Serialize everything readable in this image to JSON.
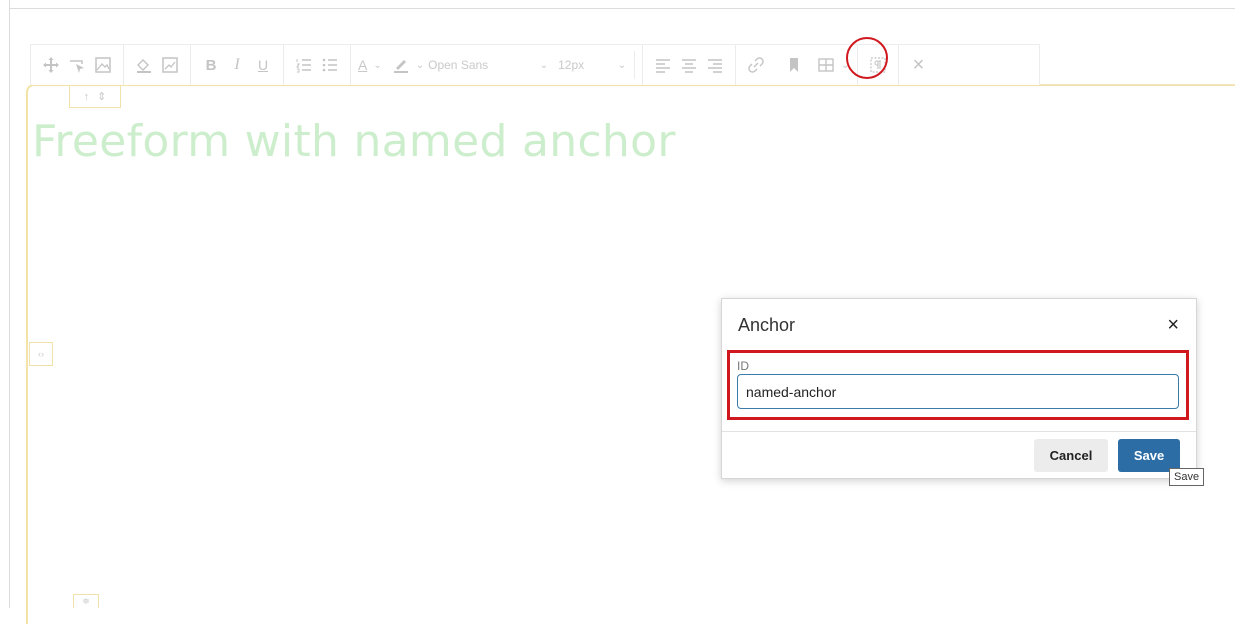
{
  "heading": "Freeform with named anchor",
  "toolbar": {
    "font_family": "Open Sans",
    "font_size": "12px",
    "bold": "B",
    "italic": "I",
    "underline": "U",
    "text_color": "A",
    "close": "×"
  },
  "block": {
    "tab_up": "↑",
    "tab_move": "⇕",
    "side_handle": "‹›",
    "bottom_handle": "≑"
  },
  "modal": {
    "title": "Anchor",
    "close": "×",
    "field_label": "ID",
    "field_value": "named-anchor",
    "cancel_label": "Cancel",
    "save_label": "Save"
  },
  "tooltip": "Save",
  "colors": {
    "accent": "#2d6da6",
    "highlight": "#d0181f",
    "heading": "#cdeecd",
    "block_border": "#f3e3a6"
  }
}
